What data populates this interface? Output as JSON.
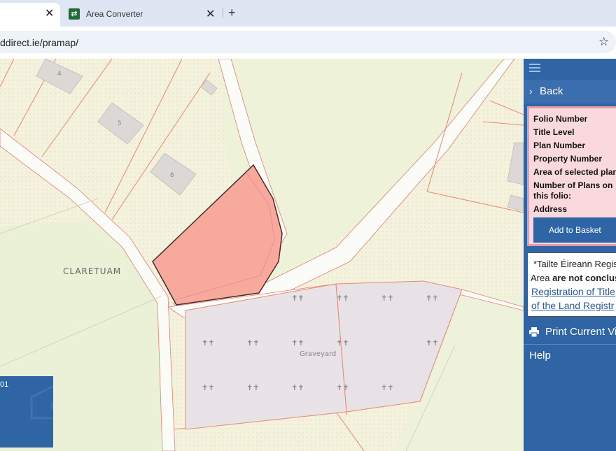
{
  "browser": {
    "tabs": [
      {
        "title": ""
      },
      {
        "title": "Area Converter"
      }
    ],
    "url": "ddirect.ie/pramap/"
  },
  "map": {
    "townland_label": "CLARETUAM",
    "graveyard_label": "Graveyard",
    "house_numbers": [
      "4",
      "5",
      "6"
    ],
    "legend_text": "01"
  },
  "panel": {
    "back_label": "Back",
    "info_fields": [
      "Folio Number",
      "Title Level",
      "Plan Number",
      "Property Number",
      "Area of selected plan",
      "Number of Plans on",
      "this folio:",
      "Address"
    ],
    "basket_label": "Add to Basket",
    "note": {
      "line1": "*Tailte Éireann Regist",
      "line2_prefix": "Area ",
      "line2_bold": "are not conclus",
      "link1": "Registration of Title",
      "link2": "of the Land Registr"
    },
    "print_label": "Print Current Vi",
    "help_label": "Help"
  },
  "colors": {
    "panel": "#2f64a5",
    "highlight_plot": "#f7a99b",
    "map_bg": "#f4f1dc"
  }
}
